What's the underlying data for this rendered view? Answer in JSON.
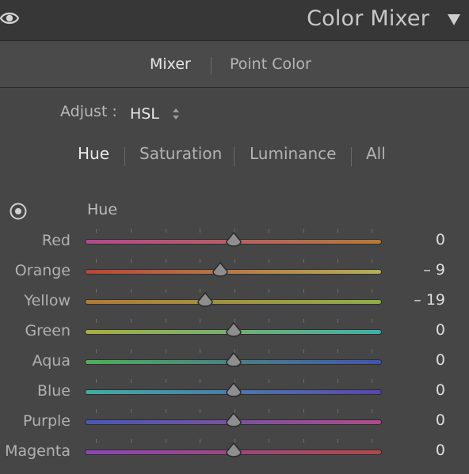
{
  "header": {
    "title": "Color Mixer",
    "visibility_icon": "eye-icon",
    "collapse_icon": "triangle-down-icon"
  },
  "mode_tabs": [
    {
      "label": "Mixer",
      "active": true
    },
    {
      "label": "Point Color",
      "active": false
    }
  ],
  "adjust": {
    "label": "Adjust :",
    "value": "HSL"
  },
  "sub_tabs": [
    {
      "label": "Hue",
      "active": true
    },
    {
      "label": "Saturation",
      "active": false
    },
    {
      "label": "Luminance",
      "active": false
    },
    {
      "label": "All",
      "active": false
    }
  ],
  "section": {
    "label": "Hue",
    "tool_icon": "target-adjust-icon"
  },
  "slider_range": [
    -100,
    100
  ],
  "sliders": [
    {
      "label": "Red",
      "value": "0",
      "numeric": 0,
      "gradient": [
        "#b14a8c",
        "#b47a3a"
      ]
    },
    {
      "label": "Orange",
      "value": "– 9",
      "numeric": -9,
      "gradient": [
        "#b6463a",
        "#b2b05a"
      ]
    },
    {
      "label": "Yellow",
      "value": "– 19",
      "numeric": -19,
      "gradient": [
        "#b07a3a",
        "#8eae4a"
      ]
    },
    {
      "label": "Green",
      "value": "0",
      "numeric": 0,
      "gradient": [
        "#a8b040",
        "#3eb0a8"
      ]
    },
    {
      "label": "Aqua",
      "value": "0",
      "numeric": 0,
      "gradient": [
        "#4eb05a",
        "#4254b0"
      ]
    },
    {
      "label": "Blue",
      "value": "0",
      "numeric": 0,
      "gradient": [
        "#3eb0a0",
        "#5a44b0"
      ]
    },
    {
      "label": "Purple",
      "value": "0",
      "numeric": 0,
      "gradient": [
        "#4658b8",
        "#b04a8a"
      ]
    },
    {
      "label": "Magenta",
      "value": "0",
      "numeric": 0,
      "gradient": [
        "#8a46b8",
        "#b04848"
      ]
    }
  ]
}
